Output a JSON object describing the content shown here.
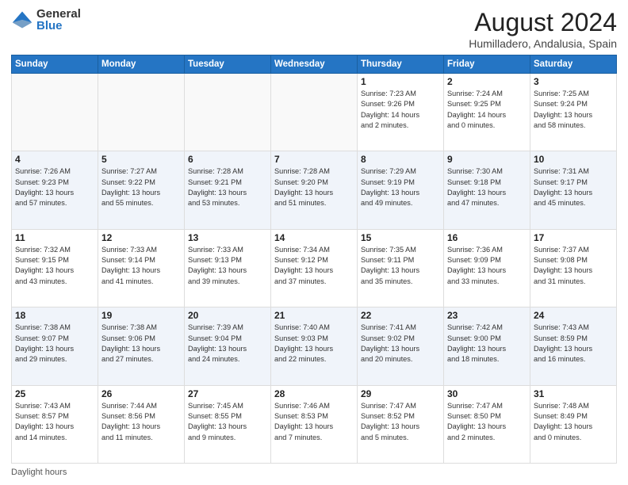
{
  "logo": {
    "general": "General",
    "blue": "Blue"
  },
  "title": "August 2024",
  "subtitle": "Humilladero, Andalusia, Spain",
  "days_header": [
    "Sunday",
    "Monday",
    "Tuesday",
    "Wednesday",
    "Thursday",
    "Friday",
    "Saturday"
  ],
  "weeks": [
    [
      {
        "num": "",
        "info": ""
      },
      {
        "num": "",
        "info": ""
      },
      {
        "num": "",
        "info": ""
      },
      {
        "num": "",
        "info": ""
      },
      {
        "num": "1",
        "info": "Sunrise: 7:23 AM\nSunset: 9:26 PM\nDaylight: 14 hours\nand 2 minutes."
      },
      {
        "num": "2",
        "info": "Sunrise: 7:24 AM\nSunset: 9:25 PM\nDaylight: 14 hours\nand 0 minutes."
      },
      {
        "num": "3",
        "info": "Sunrise: 7:25 AM\nSunset: 9:24 PM\nDaylight: 13 hours\nand 58 minutes."
      }
    ],
    [
      {
        "num": "4",
        "info": "Sunrise: 7:26 AM\nSunset: 9:23 PM\nDaylight: 13 hours\nand 57 minutes."
      },
      {
        "num": "5",
        "info": "Sunrise: 7:27 AM\nSunset: 9:22 PM\nDaylight: 13 hours\nand 55 minutes."
      },
      {
        "num": "6",
        "info": "Sunrise: 7:28 AM\nSunset: 9:21 PM\nDaylight: 13 hours\nand 53 minutes."
      },
      {
        "num": "7",
        "info": "Sunrise: 7:28 AM\nSunset: 9:20 PM\nDaylight: 13 hours\nand 51 minutes."
      },
      {
        "num": "8",
        "info": "Sunrise: 7:29 AM\nSunset: 9:19 PM\nDaylight: 13 hours\nand 49 minutes."
      },
      {
        "num": "9",
        "info": "Sunrise: 7:30 AM\nSunset: 9:18 PM\nDaylight: 13 hours\nand 47 minutes."
      },
      {
        "num": "10",
        "info": "Sunrise: 7:31 AM\nSunset: 9:17 PM\nDaylight: 13 hours\nand 45 minutes."
      }
    ],
    [
      {
        "num": "11",
        "info": "Sunrise: 7:32 AM\nSunset: 9:15 PM\nDaylight: 13 hours\nand 43 minutes."
      },
      {
        "num": "12",
        "info": "Sunrise: 7:33 AM\nSunset: 9:14 PM\nDaylight: 13 hours\nand 41 minutes."
      },
      {
        "num": "13",
        "info": "Sunrise: 7:33 AM\nSunset: 9:13 PM\nDaylight: 13 hours\nand 39 minutes."
      },
      {
        "num": "14",
        "info": "Sunrise: 7:34 AM\nSunset: 9:12 PM\nDaylight: 13 hours\nand 37 minutes."
      },
      {
        "num": "15",
        "info": "Sunrise: 7:35 AM\nSunset: 9:11 PM\nDaylight: 13 hours\nand 35 minutes."
      },
      {
        "num": "16",
        "info": "Sunrise: 7:36 AM\nSunset: 9:09 PM\nDaylight: 13 hours\nand 33 minutes."
      },
      {
        "num": "17",
        "info": "Sunrise: 7:37 AM\nSunset: 9:08 PM\nDaylight: 13 hours\nand 31 minutes."
      }
    ],
    [
      {
        "num": "18",
        "info": "Sunrise: 7:38 AM\nSunset: 9:07 PM\nDaylight: 13 hours\nand 29 minutes."
      },
      {
        "num": "19",
        "info": "Sunrise: 7:38 AM\nSunset: 9:06 PM\nDaylight: 13 hours\nand 27 minutes."
      },
      {
        "num": "20",
        "info": "Sunrise: 7:39 AM\nSunset: 9:04 PM\nDaylight: 13 hours\nand 24 minutes."
      },
      {
        "num": "21",
        "info": "Sunrise: 7:40 AM\nSunset: 9:03 PM\nDaylight: 13 hours\nand 22 minutes."
      },
      {
        "num": "22",
        "info": "Sunrise: 7:41 AM\nSunset: 9:02 PM\nDaylight: 13 hours\nand 20 minutes."
      },
      {
        "num": "23",
        "info": "Sunrise: 7:42 AM\nSunset: 9:00 PM\nDaylight: 13 hours\nand 18 minutes."
      },
      {
        "num": "24",
        "info": "Sunrise: 7:43 AM\nSunset: 8:59 PM\nDaylight: 13 hours\nand 16 minutes."
      }
    ],
    [
      {
        "num": "25",
        "info": "Sunrise: 7:43 AM\nSunset: 8:57 PM\nDaylight: 13 hours\nand 14 minutes."
      },
      {
        "num": "26",
        "info": "Sunrise: 7:44 AM\nSunset: 8:56 PM\nDaylight: 13 hours\nand 11 minutes."
      },
      {
        "num": "27",
        "info": "Sunrise: 7:45 AM\nSunset: 8:55 PM\nDaylight: 13 hours\nand 9 minutes."
      },
      {
        "num": "28",
        "info": "Sunrise: 7:46 AM\nSunset: 8:53 PM\nDaylight: 13 hours\nand 7 minutes."
      },
      {
        "num": "29",
        "info": "Sunrise: 7:47 AM\nSunset: 8:52 PM\nDaylight: 13 hours\nand 5 minutes."
      },
      {
        "num": "30",
        "info": "Sunrise: 7:47 AM\nSunset: 8:50 PM\nDaylight: 13 hours\nand 2 minutes."
      },
      {
        "num": "31",
        "info": "Sunrise: 7:48 AM\nSunset: 8:49 PM\nDaylight: 13 hours\nand 0 minutes."
      }
    ]
  ],
  "footer": {
    "daylight_label": "Daylight hours"
  }
}
